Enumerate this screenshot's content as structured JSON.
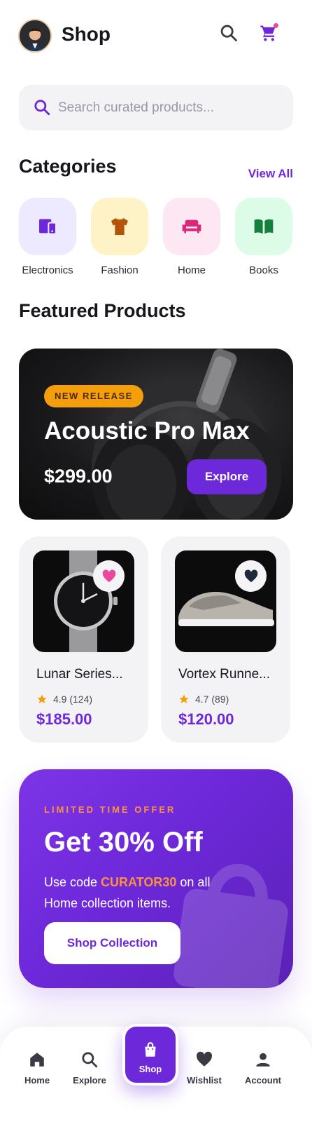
{
  "header": {
    "title": "Shop",
    "search_icon": "search-icon",
    "cart_icon": "cart-icon",
    "cart_has_badge": true
  },
  "search": {
    "placeholder": "Search curated products..."
  },
  "categories": {
    "title": "Categories",
    "view_all": "View All",
    "items": [
      {
        "label": "Electronics",
        "icon": "devices-icon",
        "bg": "#ede9fe",
        "color": "#6d28d9"
      },
      {
        "label": "Fashion",
        "icon": "shirt-icon",
        "bg": "#fef3c7",
        "color": "#b45309"
      },
      {
        "label": "Home",
        "icon": "sofa-icon",
        "bg": "#fce7f3",
        "color": "#db2777"
      },
      {
        "label": "Books",
        "icon": "book-icon",
        "bg": "#dcfce7",
        "color": "#15803d"
      }
    ]
  },
  "featured": {
    "title": "Featured Products",
    "hero": {
      "badge": "NEW RELEASE",
      "name": "Acoustic Pro Max",
      "price": "$299.00",
      "button": "Explore"
    },
    "products": [
      {
        "name": "Lunar Series...",
        "rating": "4.9 (124)",
        "price": "$185.00",
        "favorite": true,
        "fav_color": "#ec4899"
      },
      {
        "name": "Vortex Runne...",
        "rating": "4.7 (89)",
        "price": "$120.00",
        "favorite": true,
        "fav_color": "#1e293b"
      }
    ]
  },
  "promo": {
    "kicker": "LIMITED TIME OFFER",
    "title": "Get 30% Off",
    "desc_before": "Use code ",
    "code": "CURATOR30",
    "desc_after": " on all Home collection items.",
    "button": "Shop Collection"
  },
  "nav": {
    "items": [
      {
        "label": "Home",
        "icon": "home-icon"
      },
      {
        "label": "Explore",
        "icon": "search-icon"
      },
      {
        "label": "Shop",
        "icon": "shopping-bag-icon",
        "active": true
      },
      {
        "label": "Wishlist",
        "icon": "heart-icon"
      },
      {
        "label": "Account",
        "icon": "person-icon"
      }
    ]
  },
  "colors": {
    "accent": "#6d28d9",
    "orange": "#f59e0b",
    "promo_highlight": "#fb923c"
  }
}
